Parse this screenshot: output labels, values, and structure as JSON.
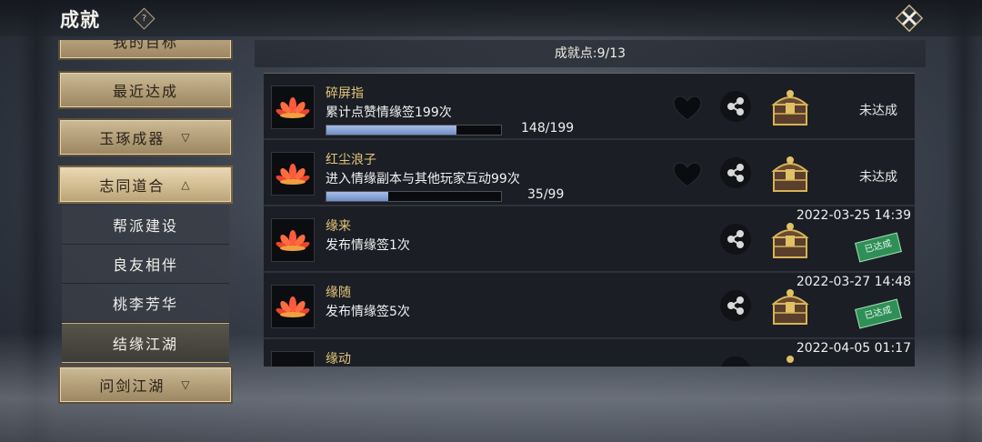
{
  "header": {
    "title": "成就",
    "help_label": "?"
  },
  "sidebar": {
    "items": [
      {
        "label": "我的目标",
        "type": "main",
        "selected": false
      },
      {
        "label": "最近达成",
        "type": "main",
        "selected": false
      },
      {
        "label": "玉琢成器",
        "type": "main",
        "selected": false,
        "expand": "collapsed"
      },
      {
        "label": "志同道合",
        "type": "main",
        "selected": true,
        "expand": "expanded"
      },
      {
        "label": "帮派建设",
        "type": "sub",
        "selected": false
      },
      {
        "label": "良友相伴",
        "type": "sub",
        "selected": false
      },
      {
        "label": "桃李芳华",
        "type": "sub",
        "selected": false
      },
      {
        "label": "结缘江湖",
        "type": "sub",
        "selected": true
      },
      {
        "label": "问剑江湖",
        "type": "main",
        "selected": false,
        "expand": "collapsed"
      }
    ]
  },
  "main": {
    "points_text": "成就点:9/13",
    "achievements": [
      {
        "name": "碎屏指",
        "desc": "累计点赞情缘签199次",
        "progress_text": "148/199",
        "progress": 0.744,
        "status": "未达成"
      },
      {
        "name": "红尘浪子",
        "desc": "进入情缘副本与其他玩家互动99次",
        "progress_text": "35/99",
        "progress": 0.354,
        "status": "未达成"
      },
      {
        "name": "缘来",
        "desc": "发布情缘签1次",
        "date": "2022-03-25 14:39",
        "stamp": "已达成"
      },
      {
        "name": "缘随",
        "desc": "发布情缘签5次",
        "date": "2022-03-27 14:48",
        "stamp": "已达成"
      },
      {
        "name": "缘动",
        "date": "2022-04-05 01:17"
      }
    ]
  },
  "colors": {
    "gold_text": "#e4c77a",
    "progress_fill": "#8aa6d8",
    "stamp_green": "#2f8f57"
  }
}
